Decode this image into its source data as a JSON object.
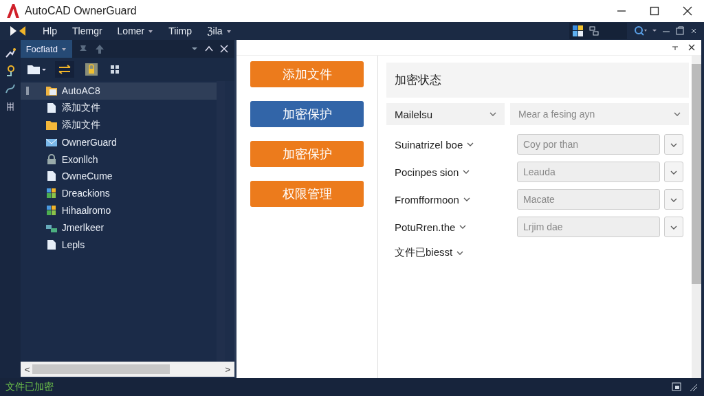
{
  "window": {
    "title": "AutoCAD OwnerGuard"
  },
  "menu": [
    {
      "label": "Hlp",
      "caret": false
    },
    {
      "label": "Tlemgr",
      "caret": false
    },
    {
      "label": "Lomer",
      "caret": true
    },
    {
      "label": "Tiimp",
      "caret": false
    },
    {
      "label": "ℨila",
      "caret": true
    }
  ],
  "panel": {
    "title": "Focfiatd",
    "scroll_symbol_left": "<",
    "scroll_symbol_right": ">"
  },
  "tree": [
    {
      "label": "AutoAC8",
      "kind": "folder-image",
      "selected": true
    },
    {
      "label": "添加文件",
      "kind": "file",
      "selected": false
    },
    {
      "label": "添加文件",
      "kind": "folder",
      "selected": false
    },
    {
      "label": "OwnerGuard",
      "kind": "mail",
      "selected": false
    },
    {
      "label": "Exonllch",
      "kind": "lock",
      "selected": false
    },
    {
      "label": "OwneCume",
      "kind": "file",
      "selected": false
    },
    {
      "label": "Dreackions",
      "kind": "grid",
      "selected": false
    },
    {
      "label": "Hihaalromo",
      "kind": "grid",
      "selected": false
    },
    {
      "label": "Jmerlkeer",
      "kind": "network",
      "selected": false
    },
    {
      "label": "Lepls",
      "kind": "file",
      "selected": false
    }
  ],
  "actions": [
    {
      "label": "添加文件",
      "kind": "orange"
    },
    {
      "label": "加密保护",
      "kind": "blue"
    },
    {
      "label": "加密保护",
      "kind": "orange"
    },
    {
      "label": "权限管理",
      "kind": "orange"
    }
  ],
  "detail": {
    "heading": "加密状态",
    "header_select": "Mailelsu",
    "header_value": "Mear a fesing ayn",
    "rows": [
      {
        "label": "Suinatrizel boe",
        "value": "Coy por than"
      },
      {
        "label": "Pocinpes sion",
        "value": "Leauda"
      },
      {
        "label": "Fromfformoon",
        "value": "Macate"
      },
      {
        "label": "PotuRren.the",
        "value": "Lrjim dae"
      }
    ],
    "footer_label": "文件已biesst"
  },
  "status_bar": {
    "text": "文件已加密"
  }
}
